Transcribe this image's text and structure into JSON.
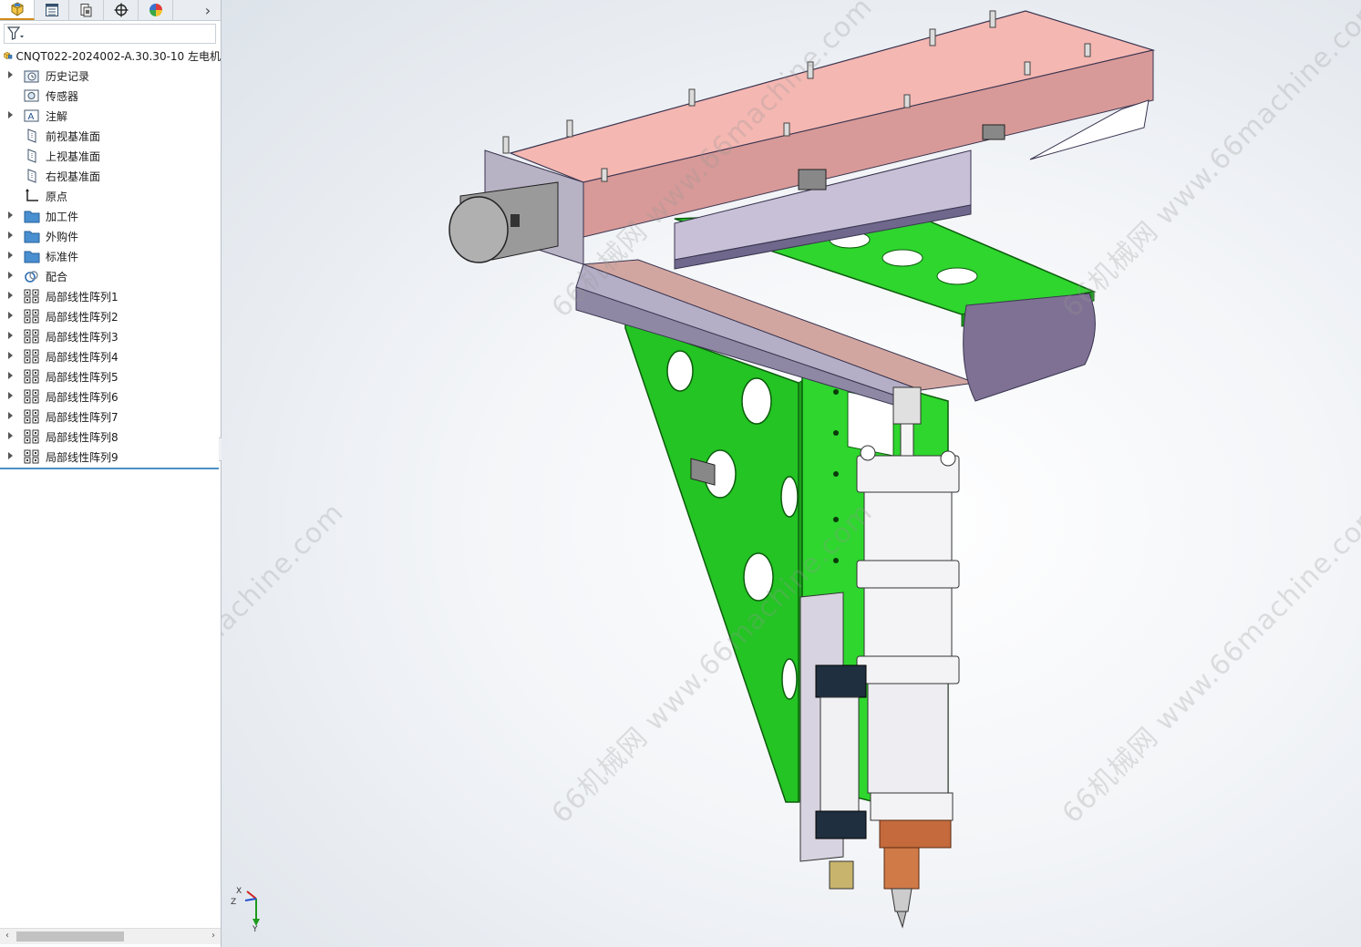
{
  "panel": {
    "tabs": [
      {
        "name": "feature-manager-tab",
        "icon": "feature-tree-icon",
        "active": true
      },
      {
        "name": "property-manager-tab",
        "icon": "property-list-icon",
        "active": false
      },
      {
        "name": "configuration-manager-tab",
        "icon": "configuration-icon",
        "active": false
      },
      {
        "name": "dimxpert-tab",
        "icon": "crosshair-icon",
        "active": false
      },
      {
        "name": "display-manager-tab",
        "icon": "color-wheel-icon",
        "active": false
      }
    ],
    "more_glyph": "›",
    "filter_icon": "filter-funnel-icon",
    "root_label": "CNQT022-2024002-A.30.30-10  左电机",
    "tree": [
      {
        "label": "历史记录",
        "icon": "history-folder-icon",
        "expandable": true
      },
      {
        "label": "传感器",
        "icon": "sensor-icon",
        "expandable": false
      },
      {
        "label": "注解",
        "icon": "annotation-icon",
        "expandable": true
      },
      {
        "label": "前视基准面",
        "icon": "plane-icon",
        "expandable": false
      },
      {
        "label": "上视基准面",
        "icon": "plane-icon",
        "expandable": false
      },
      {
        "label": "右视基准面",
        "icon": "plane-icon",
        "expandable": false
      },
      {
        "label": "原点",
        "icon": "origin-icon",
        "expandable": false
      },
      {
        "label": "加工件",
        "icon": "folder-icon",
        "expandable": true
      },
      {
        "label": "外购件",
        "icon": "folder-icon",
        "expandable": true
      },
      {
        "label": "标准件",
        "icon": "folder-icon",
        "expandable": true
      },
      {
        "label": "配合",
        "icon": "mates-icon",
        "expandable": true
      },
      {
        "label": "局部线性阵列1",
        "icon": "linear-pattern-icon",
        "expandable": true
      },
      {
        "label": "局部线性阵列2",
        "icon": "linear-pattern-icon",
        "expandable": true
      },
      {
        "label": "局部线性阵列3",
        "icon": "linear-pattern-icon",
        "expandable": true
      },
      {
        "label": "局部线性阵列4",
        "icon": "linear-pattern-icon",
        "expandable": true
      },
      {
        "label": "局部线性阵列5",
        "icon": "linear-pattern-icon",
        "expandable": true
      },
      {
        "label": "局部线性阵列6",
        "icon": "linear-pattern-icon",
        "expandable": true
      },
      {
        "label": "局部线性阵列7",
        "icon": "linear-pattern-icon",
        "expandable": true
      },
      {
        "label": "局部线性阵列8",
        "icon": "linear-pattern-icon",
        "expandable": true
      },
      {
        "label": "局部线性阵列9",
        "icon": "linear-pattern-icon",
        "expandable": true
      }
    ],
    "scroll_left": "‹",
    "scroll_right": "›"
  },
  "viewport": {
    "watermark": "66机械网 www.66machine.com",
    "triad": {
      "x": "X",
      "y": "Y",
      "z": "Z"
    },
    "colors": {
      "rail_top": "#f1b9b4",
      "rail_side": "#b8b3c4",
      "plate_green": "#2ed62e",
      "motor_grey": "#a9a9a9",
      "cylinder_white": "#f2f2f4",
      "nozzle_copper": "#c46a3c"
    }
  }
}
